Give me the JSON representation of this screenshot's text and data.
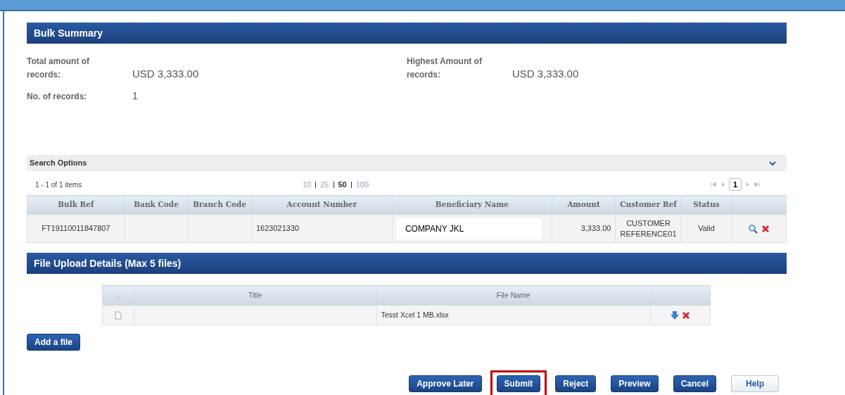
{
  "bulk_summary": {
    "title": "Bulk Summary",
    "fields": [
      {
        "label": "Total amount of records:",
        "value": "USD 3,333.00"
      },
      {
        "label": "Highest Amount of records:",
        "value": "USD 3,333.00"
      },
      {
        "label": "No. of records:",
        "value": "1"
      }
    ]
  },
  "search_options": {
    "title": "Search Options",
    "expanded": false
  },
  "records": {
    "count": "1 - 1 of 1 items",
    "page_sizes": [
      {
        "label": "10",
        "selected": false
      },
      {
        "label": "25",
        "selected": false
      },
      {
        "label": "50",
        "selected": true
      },
      {
        "label": "100",
        "selected": false
      }
    ],
    "page": "1",
    "columns": [
      "Bulk Ref",
      "Bank Code",
      "Branch Code",
      "Account Number",
      "Beneficiary Name",
      "Amount",
      "Customer Ref",
      "Status"
    ],
    "rows": [
      {
        "bulk_ref": "FT19110011847807",
        "bank_code": "",
        "branch_code": "",
        "account_number": "1623021330",
        "beneficiary_name": "COMPANY JKL",
        "amount": "3,333.00",
        "customer_ref": "CUSTOMER REFERENCE01",
        "status": "Valid"
      }
    ]
  },
  "file_upload": {
    "title": "File Upload Details (Max 5 files)",
    "columns": [
      ".",
      "Title",
      "File Name"
    ],
    "rows": [
      {
        "title": "",
        "file_name": "Tesst Xcel 1 MB.xlsx"
      }
    ],
    "add_button": "Add a file"
  },
  "actions": [
    {
      "label": "Approve Later",
      "kind": "primary",
      "highlighted": false
    },
    {
      "label": "Submit",
      "kind": "primary",
      "highlighted": true
    },
    {
      "label": "Reject",
      "kind": "primary",
      "highlighted": false
    },
    {
      "label": "Preview",
      "kind": "primary",
      "highlighted": false
    },
    {
      "label": "Cancel",
      "kind": "primary",
      "highlighted": false
    },
    {
      "label": "Help",
      "kind": "light",
      "highlighted": false
    }
  ]
}
